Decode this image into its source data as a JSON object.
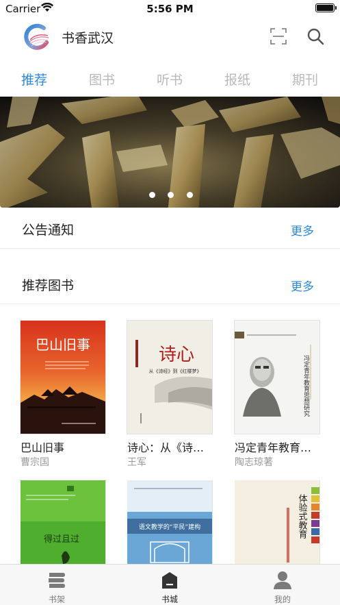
{
  "status_bar": {
    "carrier": "Carrier",
    "time": "5:56 PM"
  },
  "header": {
    "title": "书香武汉"
  },
  "tabs": [
    {
      "label": "推荐",
      "active": true
    },
    {
      "label": "图书",
      "active": false
    },
    {
      "label": "听书",
      "active": false
    },
    {
      "label": "报纸",
      "active": false
    },
    {
      "label": "期刊",
      "active": false
    }
  ],
  "banner": {
    "slide_count": 3
  },
  "announcements": {
    "title": "公告通知",
    "more": "更多"
  },
  "recommended": {
    "title": "推荐图书",
    "more": "更多",
    "books": [
      {
        "title": "巴山旧事",
        "author": "曹宗国",
        "cover_title": "巴山旧事"
      },
      {
        "title": "诗心：从《诗…",
        "author": "王军",
        "cover_title": "诗心",
        "cover_subtitle": "从《诗经》到《红楼梦》"
      },
      {
        "title": "冯定青年教育…",
        "author": "陶志琼著",
        "cover_title": "冯定青年教育思想研究"
      },
      {
        "title": "",
        "author": "",
        "cover_title": "得过且过"
      },
      {
        "title": "",
        "author": "",
        "cover_title": "语文教学的“平民”建构"
      },
      {
        "title": "",
        "author": "",
        "cover_title": "体验式教育"
      }
    ]
  },
  "tabbar": [
    {
      "label": "书架",
      "icon": "bookshelf-icon",
      "active": false
    },
    {
      "label": "书城",
      "icon": "bookstore-icon",
      "active": true
    },
    {
      "label": "我的",
      "icon": "profile-icon",
      "active": false
    }
  ],
  "colors": {
    "accent": "#2e88d8",
    "inactive_tab": "#b9b9b9",
    "muted_text": "#9a9a9a"
  }
}
